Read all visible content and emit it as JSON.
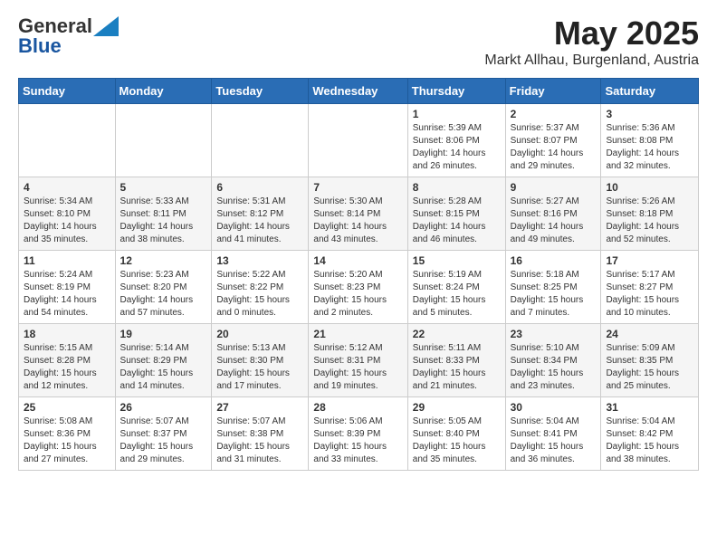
{
  "header": {
    "logo_line1": "General",
    "logo_line2": "Blue",
    "title": "May 2025",
    "location": "Markt Allhau, Burgenland, Austria"
  },
  "weekdays": [
    "Sunday",
    "Monday",
    "Tuesday",
    "Wednesday",
    "Thursday",
    "Friday",
    "Saturday"
  ],
  "weeks": [
    [
      {
        "day": "",
        "info": ""
      },
      {
        "day": "",
        "info": ""
      },
      {
        "day": "",
        "info": ""
      },
      {
        "day": "",
        "info": ""
      },
      {
        "day": "1",
        "info": "Sunrise: 5:39 AM\nSunset: 8:06 PM\nDaylight: 14 hours\nand 26 minutes."
      },
      {
        "day": "2",
        "info": "Sunrise: 5:37 AM\nSunset: 8:07 PM\nDaylight: 14 hours\nand 29 minutes."
      },
      {
        "day": "3",
        "info": "Sunrise: 5:36 AM\nSunset: 8:08 PM\nDaylight: 14 hours\nand 32 minutes."
      }
    ],
    [
      {
        "day": "4",
        "info": "Sunrise: 5:34 AM\nSunset: 8:10 PM\nDaylight: 14 hours\nand 35 minutes."
      },
      {
        "day": "5",
        "info": "Sunrise: 5:33 AM\nSunset: 8:11 PM\nDaylight: 14 hours\nand 38 minutes."
      },
      {
        "day": "6",
        "info": "Sunrise: 5:31 AM\nSunset: 8:12 PM\nDaylight: 14 hours\nand 41 minutes."
      },
      {
        "day": "7",
        "info": "Sunrise: 5:30 AM\nSunset: 8:14 PM\nDaylight: 14 hours\nand 43 minutes."
      },
      {
        "day": "8",
        "info": "Sunrise: 5:28 AM\nSunset: 8:15 PM\nDaylight: 14 hours\nand 46 minutes."
      },
      {
        "day": "9",
        "info": "Sunrise: 5:27 AM\nSunset: 8:16 PM\nDaylight: 14 hours\nand 49 minutes."
      },
      {
        "day": "10",
        "info": "Sunrise: 5:26 AM\nSunset: 8:18 PM\nDaylight: 14 hours\nand 52 minutes."
      }
    ],
    [
      {
        "day": "11",
        "info": "Sunrise: 5:24 AM\nSunset: 8:19 PM\nDaylight: 14 hours\nand 54 minutes."
      },
      {
        "day": "12",
        "info": "Sunrise: 5:23 AM\nSunset: 8:20 PM\nDaylight: 14 hours\nand 57 minutes."
      },
      {
        "day": "13",
        "info": "Sunrise: 5:22 AM\nSunset: 8:22 PM\nDaylight: 15 hours\nand 0 minutes."
      },
      {
        "day": "14",
        "info": "Sunrise: 5:20 AM\nSunset: 8:23 PM\nDaylight: 15 hours\nand 2 minutes."
      },
      {
        "day": "15",
        "info": "Sunrise: 5:19 AM\nSunset: 8:24 PM\nDaylight: 15 hours\nand 5 minutes."
      },
      {
        "day": "16",
        "info": "Sunrise: 5:18 AM\nSunset: 8:25 PM\nDaylight: 15 hours\nand 7 minutes."
      },
      {
        "day": "17",
        "info": "Sunrise: 5:17 AM\nSunset: 8:27 PM\nDaylight: 15 hours\nand 10 minutes."
      }
    ],
    [
      {
        "day": "18",
        "info": "Sunrise: 5:15 AM\nSunset: 8:28 PM\nDaylight: 15 hours\nand 12 minutes."
      },
      {
        "day": "19",
        "info": "Sunrise: 5:14 AM\nSunset: 8:29 PM\nDaylight: 15 hours\nand 14 minutes."
      },
      {
        "day": "20",
        "info": "Sunrise: 5:13 AM\nSunset: 8:30 PM\nDaylight: 15 hours\nand 17 minutes."
      },
      {
        "day": "21",
        "info": "Sunrise: 5:12 AM\nSunset: 8:31 PM\nDaylight: 15 hours\nand 19 minutes."
      },
      {
        "day": "22",
        "info": "Sunrise: 5:11 AM\nSunset: 8:33 PM\nDaylight: 15 hours\nand 21 minutes."
      },
      {
        "day": "23",
        "info": "Sunrise: 5:10 AM\nSunset: 8:34 PM\nDaylight: 15 hours\nand 23 minutes."
      },
      {
        "day": "24",
        "info": "Sunrise: 5:09 AM\nSunset: 8:35 PM\nDaylight: 15 hours\nand 25 minutes."
      }
    ],
    [
      {
        "day": "25",
        "info": "Sunrise: 5:08 AM\nSunset: 8:36 PM\nDaylight: 15 hours\nand 27 minutes."
      },
      {
        "day": "26",
        "info": "Sunrise: 5:07 AM\nSunset: 8:37 PM\nDaylight: 15 hours\nand 29 minutes."
      },
      {
        "day": "27",
        "info": "Sunrise: 5:07 AM\nSunset: 8:38 PM\nDaylight: 15 hours\nand 31 minutes."
      },
      {
        "day": "28",
        "info": "Sunrise: 5:06 AM\nSunset: 8:39 PM\nDaylight: 15 hours\nand 33 minutes."
      },
      {
        "day": "29",
        "info": "Sunrise: 5:05 AM\nSunset: 8:40 PM\nDaylight: 15 hours\nand 35 minutes."
      },
      {
        "day": "30",
        "info": "Sunrise: 5:04 AM\nSunset: 8:41 PM\nDaylight: 15 hours\nand 36 minutes."
      },
      {
        "day": "31",
        "info": "Sunrise: 5:04 AM\nSunset: 8:42 PM\nDaylight: 15 hours\nand 38 minutes."
      }
    ]
  ]
}
